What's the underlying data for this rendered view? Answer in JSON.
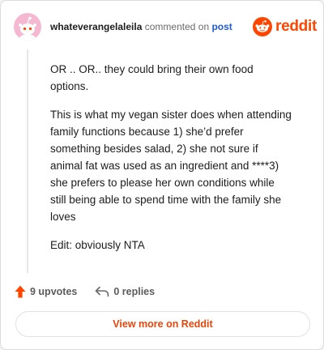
{
  "comment": {
    "username": "whateverangelaleila",
    "commented_on": "commented on",
    "post_link": "post",
    "paragraphs": [
      "OR .. OR.. they could bring their own food options.",
      "This is what my vegan sister does when attending family functions because 1) she’d prefer something besides salad, 2) she not sure if animal fat was used as an ingredient and ****3) she prefers to please her own conditions while still being able to spend time with the family she loves",
      "Edit: obviously NTA"
    ]
  },
  "brand": {
    "name": "reddit",
    "icon": "reddit-logo-icon",
    "color": "#ff4500"
  },
  "actions": {
    "upvotes": "9 upvotes",
    "replies": "0 replies",
    "upvote_icon": "upvote-arrow-icon",
    "reply_icon": "reply-arrow-icon"
  },
  "view_more": "View more on Reddit",
  "colors": {
    "accent": "#ff4500",
    "link": "#1f5bd6",
    "avatar_bg": "#f6b8d0"
  }
}
